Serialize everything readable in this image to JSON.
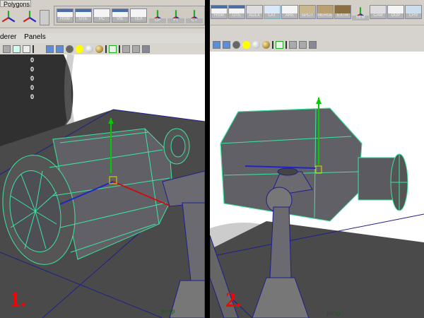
{
  "panel1": {
    "shelf_tab": "Polygons",
    "shelf_buttons": [
      "HSW",
      "UTE",
      "PC",
      "VIE",
      "TEX",
      "CP",
      "FT",
      "CT"
    ],
    "menu": [
      "derer",
      "Panels"
    ],
    "channel_values": [
      "0",
      "0",
      "0",
      "0",
      "0"
    ],
    "step_label": "1.",
    "camera_label": "persp"
  },
  "panel2": {
    "shelf_buttons": [
      "HSW",
      "UTE",
      "ADLX",
      "LAT",
      "ARE",
      "SPLIT",
      "MERGE",
      "EXTR",
      "SEM",
      "CAM",
      "DUP",
      "CRV"
    ],
    "step_label": "2.",
    "camera_label": "persp"
  },
  "colors": {
    "wire": "#3ce6a0",
    "edge": "#1e1e8c",
    "mesh": "#5a5a60",
    "ground": "#4a4a4a",
    "label": "#ff0000"
  }
}
